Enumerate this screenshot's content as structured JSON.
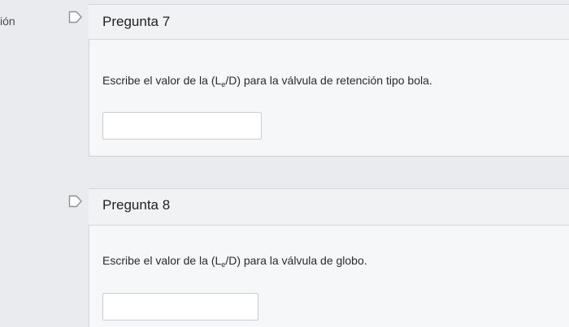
{
  "sidebar": {
    "cut_label": "ión"
  },
  "questions": [
    {
      "title": "Pregunta 7",
      "prompt_before": "Escribe el valor de la (L",
      "prompt_sub": "e",
      "prompt_after": "/D) para la válvula de retención tipo bola.",
      "answer_value": ""
    },
    {
      "title": "Pregunta 8",
      "prompt_before": "Escribe el valor de la (L",
      "prompt_sub": "e",
      "prompt_after": "/D) para la válvula de globo.",
      "answer_value": ""
    }
  ],
  "icons": {
    "flag": "flag-outline-icon"
  }
}
